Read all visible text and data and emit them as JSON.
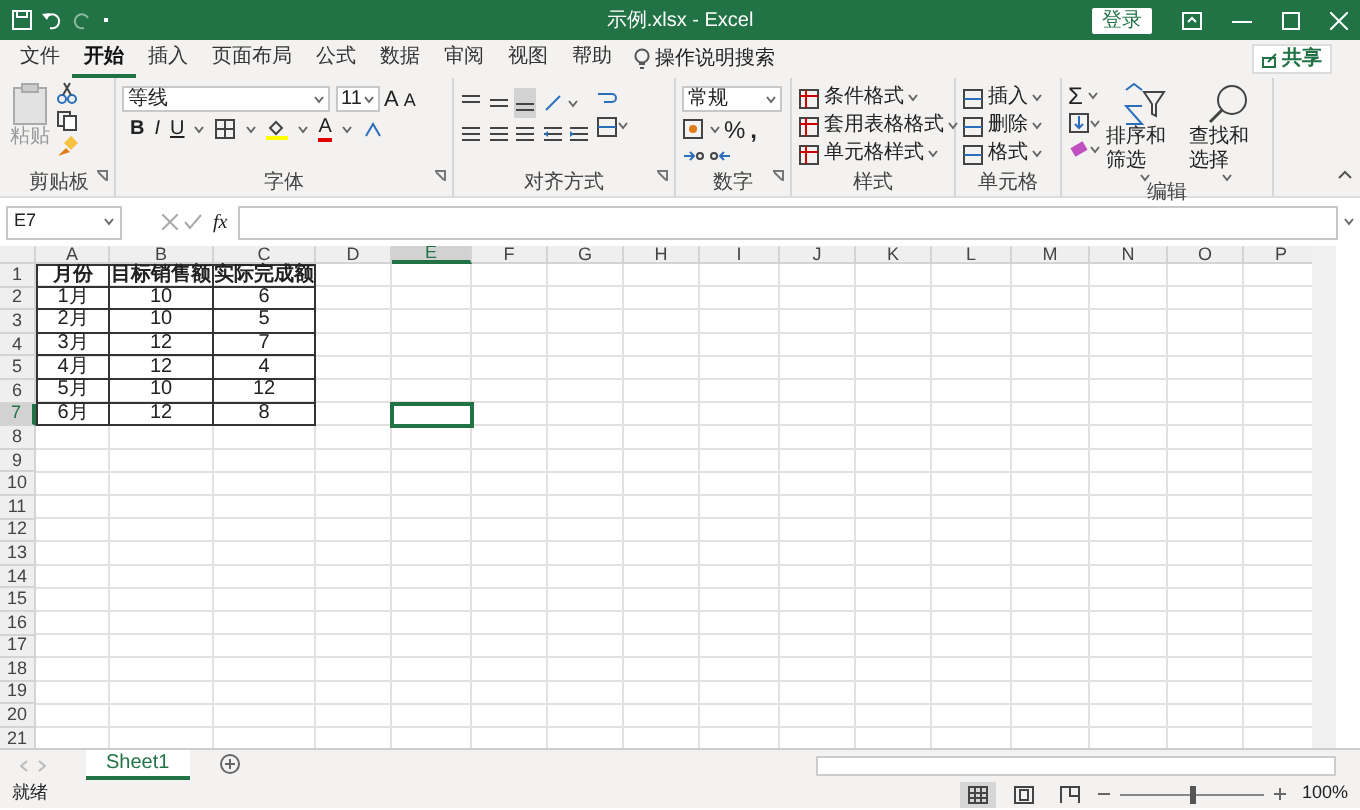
{
  "title_bar": {
    "title": "示例.xlsx  -  Excel",
    "login_button": "登录"
  },
  "menu_tabs": [
    {
      "label": "文件",
      "selected": false
    },
    {
      "label": "开始",
      "selected": true
    },
    {
      "label": "插入",
      "selected": false
    },
    {
      "label": "页面布局",
      "selected": false
    },
    {
      "label": "公式",
      "selected": false
    },
    {
      "label": "数据",
      "selected": false
    },
    {
      "label": "审阅",
      "selected": false
    },
    {
      "label": "视图",
      "selected": false
    },
    {
      "label": "帮助",
      "selected": false
    }
  ],
  "tell_me": "操作说明搜索",
  "share_button": "共享",
  "ribbon": {
    "clipboard": {
      "paste": "粘贴",
      "label": "剪贴板"
    },
    "font": {
      "font_name": "等线",
      "font_size": "11",
      "grow": "A",
      "shrink": "A",
      "bold": "B",
      "italic": "I",
      "underline": "U",
      "font_color": "A",
      "label": "字体"
    },
    "alignment": {
      "label": "对齐方式"
    },
    "number": {
      "format": "常规",
      "percent": "%",
      "comma": ",",
      "label": "数字"
    },
    "styles": {
      "items": [
        "条件格式",
        "套用表格格式",
        "单元格样式"
      ],
      "label": "样式"
    },
    "cells": {
      "items": [
        "插入",
        "删除",
        "格式"
      ],
      "label": "单元格"
    },
    "editing": {
      "sum": "Σ",
      "items": [
        "排序和筛选",
        "查找和选择"
      ],
      "label": "编辑"
    }
  },
  "formula_bar": {
    "name_box": "E7",
    "fx": "fx"
  },
  "sheet": {
    "columns": [
      {
        "label": "A",
        "selected": false
      },
      {
        "label": "B",
        "selected": false
      },
      {
        "label": "C",
        "selected": false
      },
      {
        "label": "D",
        "selected": false
      },
      {
        "label": "E",
        "selected": true
      },
      {
        "label": "F",
        "selected": false
      },
      {
        "label": "G",
        "selected": false
      },
      {
        "label": "H",
        "selected": false
      },
      {
        "label": "I",
        "selected": false
      },
      {
        "label": "J",
        "selected": false
      },
      {
        "label": "K",
        "selected": false
      },
      {
        "label": "L",
        "selected": false
      },
      {
        "label": "M",
        "selected": false
      },
      {
        "label": "N",
        "selected": false
      },
      {
        "label": "O",
        "selected": false
      },
      {
        "label": "P",
        "selected": false
      }
    ],
    "rows": [
      {
        "number": "1",
        "kind": "header",
        "selected": false,
        "cells": [
          "月份",
          "目标销售额",
          "实际完成额"
        ]
      },
      {
        "number": "2",
        "kind": "data",
        "selected": false,
        "cells": [
          "1月",
          "10",
          "6"
        ]
      },
      {
        "number": "3",
        "kind": "data",
        "selected": false,
        "cells": [
          "2月",
          "10",
          "5"
        ]
      },
      {
        "number": "4",
        "kind": "data",
        "selected": false,
        "cells": [
          "3月",
          "12",
          "7"
        ]
      },
      {
        "number": "5",
        "kind": "data",
        "selected": false,
        "cells": [
          "4月",
          "12",
          "4"
        ]
      },
      {
        "number": "6",
        "kind": "data",
        "selected": false,
        "cells": [
          "5月",
          "10",
          "12"
        ]
      },
      {
        "number": "7",
        "kind": "data",
        "selected": true,
        "cells": [
          "6月",
          "12",
          "8"
        ]
      },
      {
        "number": "8",
        "kind": "empty",
        "selected": false
      },
      {
        "number": "9",
        "kind": "empty",
        "selected": false
      },
      {
        "number": "10",
        "kind": "empty",
        "selected": false
      },
      {
        "number": "11",
        "kind": "empty",
        "selected": false
      },
      {
        "number": "12",
        "kind": "empty",
        "selected": false
      },
      {
        "number": "13",
        "kind": "empty",
        "selected": false
      },
      {
        "number": "14",
        "kind": "empty",
        "selected": false
      },
      {
        "number": "15",
        "kind": "empty",
        "selected": false
      },
      {
        "number": "16",
        "kind": "empty",
        "selected": false
      },
      {
        "number": "17",
        "kind": "empty",
        "selected": false
      },
      {
        "number": "18",
        "kind": "empty",
        "selected": false
      },
      {
        "number": "19",
        "kind": "empty",
        "selected": false
      },
      {
        "number": "20",
        "kind": "empty",
        "selected": false
      },
      {
        "number": "21",
        "kind": "empty",
        "selected": false
      }
    ]
  },
  "sheet_tabs": [
    {
      "label": "Sheet1",
      "selected": true
    }
  ],
  "status_bar": {
    "status": "就绪",
    "view_buttons": [
      {
        "kind": "normal",
        "selected": true
      },
      {
        "kind": "page_layout",
        "selected": false
      },
      {
        "kind": "page_break",
        "selected": false
      }
    ],
    "zoom": {
      "level": 0.5,
      "reading": "100%"
    }
  }
}
